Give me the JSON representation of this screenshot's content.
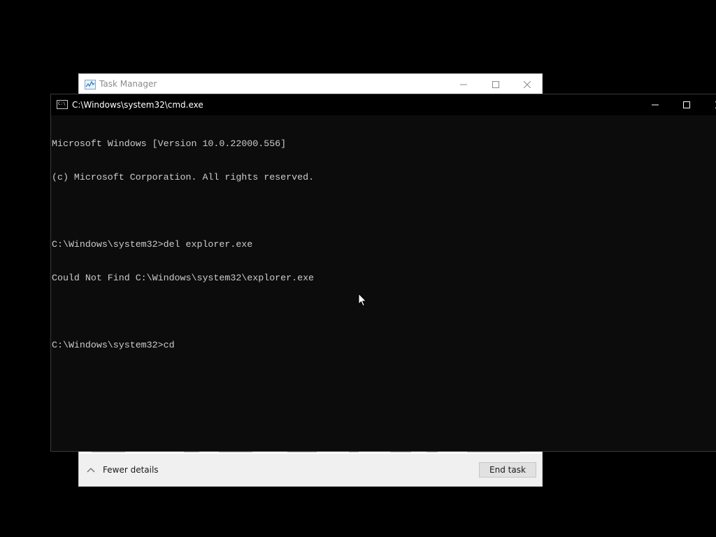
{
  "desktop": {
    "background": "#000000"
  },
  "task_manager": {
    "title": "Task Manager",
    "icon": "task-manager-chart-icon",
    "controls": [
      "minimize-icon",
      "maximize-icon",
      "close-icon"
    ],
    "footer": {
      "fewer_details_label": "Fewer details",
      "end_task_label": "End task"
    }
  },
  "cmd": {
    "title": "C:\\Windows\\system32\\cmd.exe",
    "icon_glyph": "C:\\",
    "background": "#0c0c0c",
    "text_color": "#cccccc",
    "lines": [
      "Microsoft Windows [Version 10.0.22000.556]",
      "(c) Microsoft Corporation. All rights reserved.",
      "",
      "C:\\Windows\\system32>del explorer.exe",
      "Could Not Find C:\\Windows\\system32\\explorer.exe",
      "",
      "C:\\Windows\\system32>cd"
    ]
  }
}
